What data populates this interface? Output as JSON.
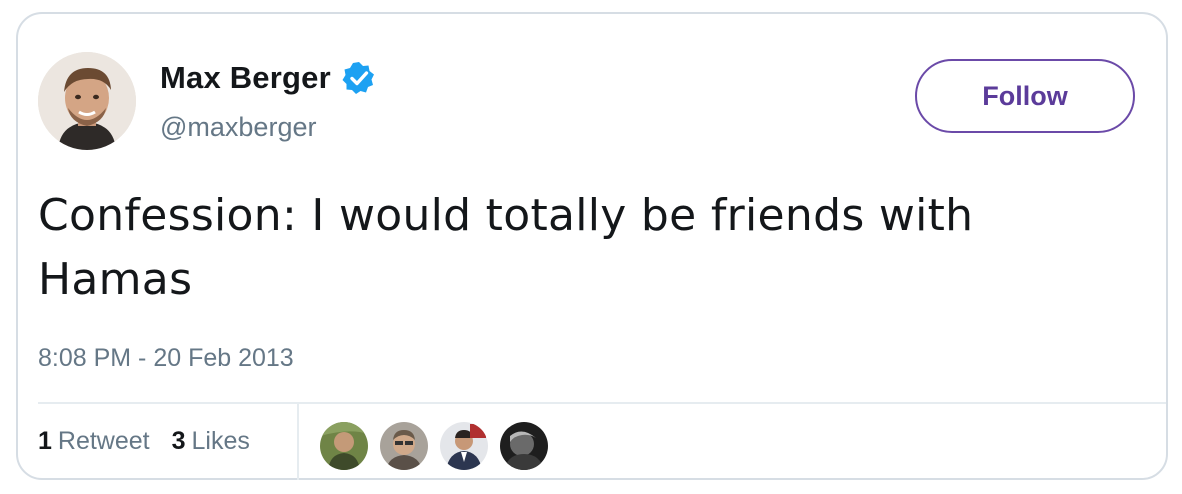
{
  "author": {
    "display_name": "Max Berger",
    "handle": "@maxberger",
    "verified": true,
    "avatar_icon": "profile-photo",
    "verified_color": "#1da1f2"
  },
  "follow_button": {
    "label": "Follow",
    "color": "#5b3b9a"
  },
  "tweet": {
    "text": "Confession: I would totally be friends with Hamas",
    "timestamp": "8:08 PM - 20 Feb 2013"
  },
  "stats": {
    "retweets_count": "1",
    "retweets_label": "Retweet",
    "likes_count": "3",
    "likes_label": "Likes"
  },
  "liked_by": [
    {
      "name": "liker-avatar-1",
      "color": "#5a6e3a"
    },
    {
      "name": "liker-avatar-2",
      "color": "#8a7a6a"
    },
    {
      "name": "liker-avatar-3",
      "color": "#3c4a6a"
    },
    {
      "name": "liker-avatar-4",
      "color": "#2b2b2b"
    }
  ]
}
